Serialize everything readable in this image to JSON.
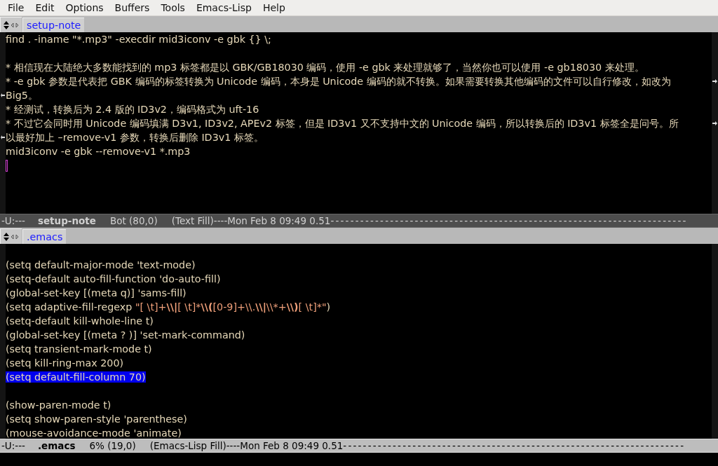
{
  "menu_bar": [
    "File",
    "Edit",
    "Options",
    "Buffers",
    "Tools",
    "Emacs-Lisp",
    "Help"
  ],
  "windows": [
    {
      "tab": {
        "label": "setup-note",
        "selected": true
      },
      "lines": [
        {
          "segments": [
            {
              "kind": "text",
              "text": "find . -iname \"*.mp3\" -execdir mid3iconv -e gbk {} \\;"
            }
          ]
        },
        {
          "blank_before": true,
          "segments": [
            {
              "kind": "text",
              "text": "* 相信现在大陆绝大多数能找到的 mp3 标签都是以 GBK/GB18030 编码，使用 -e gbk 来处理就够了，当然你也可以使用 -e gb18030 来处理。"
            }
          ]
        },
        {
          "segments": [
            {
              "kind": "text",
              "text": "* -e gbk 参数是代表把 GBK 编码的标签转换为 Unicode 编码，本身是 Unicode 编码的就不转换。如果需要转换其他编码的文件可以自行修改，如改为"
            }
          ],
          "continued": true
        },
        {
          "segments": [
            {
              "kind": "text",
              "text": "Big5。"
            }
          ]
        },
        {
          "segments": [
            {
              "kind": "text",
              "text": "* 经测试，转换后为 2.4 版的 ID3v2，编码格式为 uft-16"
            }
          ]
        },
        {
          "segments": [
            {
              "kind": "text",
              "text": "* 不过它会同时用 Unicode 编码填满 D3v1, ID3v2, APEv2 标签，但是 ID3v1 又不支持中文的 Unicode 编码，所以转换后的 ID3v1 标签全是问号。所"
            }
          ],
          "continued": true
        },
        {
          "segments": [
            {
              "kind": "text",
              "text": "以最好加上 –remove-v1 参数，转换后删除 ID3v1 标签。"
            }
          ]
        },
        {
          "segments": [
            {
              "kind": "text",
              "text": "mid3iconv -e gbk --remove-v1 *.mp3"
            }
          ]
        },
        {
          "cursor": true
        }
      ],
      "mode_line": {
        "active": false,
        "status": "-U:---",
        "buffer": "setup-note",
        "position": "Bot (80,0)",
        "mode": "(Text Fill)----Mon Feb  8 09:49 0.51",
        "fill": "------------------------------------------------------------------------"
      }
    },
    {
      "tab": {
        "label": ".emacs",
        "selected": true
      },
      "lines": [
        {
          "blank_before": true,
          "segments": [
            {
              "kind": "text",
              "text": "(setq default-major-mode 'text-mode)"
            }
          ]
        },
        {
          "segments": [
            {
              "kind": "text",
              "text": "(setq-default auto-fill-function 'do-auto-fill)"
            }
          ]
        },
        {
          "segments": [
            {
              "kind": "text",
              "text": "(global-set-key [(meta q)] 'sams-fill)"
            }
          ]
        },
        {
          "segments": [
            {
              "kind": "text",
              "text": "(setq adaptive-fill-regexp "
            },
            {
              "kind": "string",
              "text": "\"[ \\t]+"
            },
            {
              "kind": "escape",
              "text": "\\\\|"
            },
            {
              "kind": "string",
              "text": "[ \\t]*"
            },
            {
              "kind": "escape",
              "text": "\\\\("
            },
            {
              "kind": "string",
              "text": "[0-9]+\\\\."
            },
            {
              "kind": "escape",
              "text": "\\\\|"
            },
            {
              "kind": "string",
              "text": "\\\\*+"
            },
            {
              "kind": "escape",
              "text": "\\\\)"
            },
            {
              "kind": "string",
              "text": "[ \\t]*\""
            },
            {
              "kind": "text",
              "text": ")"
            }
          ]
        },
        {
          "segments": [
            {
              "kind": "text",
              "text": "(setq-default kill-whole-line t)"
            }
          ]
        },
        {
          "segments": [
            {
              "kind": "text",
              "text": "(global-set-key [(meta ? )] 'set-mark-command)"
            }
          ]
        },
        {
          "segments": [
            {
              "kind": "text",
              "text": "(setq transient-mark-mode t)"
            }
          ]
        },
        {
          "segments": [
            {
              "kind": "text",
              "text": "(setq kill-ring-max 200)"
            }
          ]
        },
        {
          "segments": [
            {
              "kind": "text",
              "text": "(setq default-fill-column 70)"
            }
          ],
          "region": true
        },
        {
          "blank_before": true,
          "segments": [
            {
              "kind": "text",
              "text": "(show-paren-mode t)"
            }
          ]
        },
        {
          "segments": [
            {
              "kind": "text",
              "text": "(setq show-paren-style 'parenthese)"
            }
          ]
        },
        {
          "segments": [
            {
              "kind": "text",
              "text": "(mouse-avoidance-mode 'animate)"
            }
          ]
        }
      ],
      "mode_line": {
        "active": true,
        "status": "-U:---",
        "buffer": ".emacs",
        "position": "6% (19,0)",
        "mode": "(Emacs-Lisp Fill)----Mon Feb  8 09:49 0.51",
        "fill": "---------------------------------------------------------------------"
      }
    }
  ]
}
